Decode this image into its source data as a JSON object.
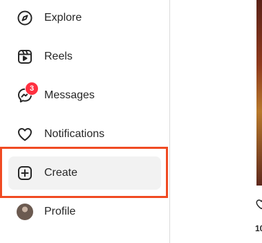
{
  "sidebar": {
    "items": [
      {
        "label": "Explore",
        "icon": "compass-icon"
      },
      {
        "label": "Reels",
        "icon": "reels-icon"
      },
      {
        "label": "Messages",
        "icon": "messenger-icon",
        "badge": "3"
      },
      {
        "label": "Notifications",
        "icon": "heart-icon"
      },
      {
        "label": "Create",
        "icon": "plus-square-icon",
        "active": true
      },
      {
        "label": "Profile",
        "icon": "avatar"
      }
    ]
  },
  "annotation": {
    "highlight_color": "#f04a22"
  },
  "preview": {
    "like_count_fragment": "10"
  },
  "colors": {
    "text": "#262626",
    "badge": "#ff3040",
    "active_bg": "#f2f2f2",
    "border": "#dbdbdb"
  }
}
